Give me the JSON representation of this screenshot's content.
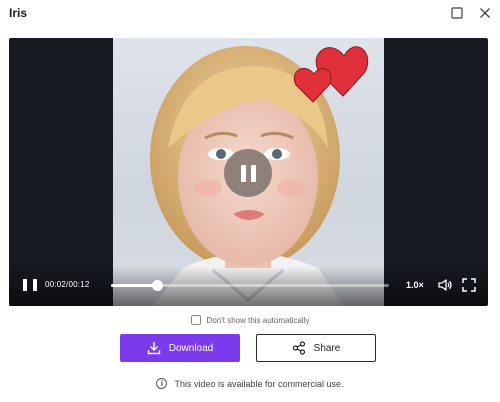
{
  "window": {
    "title": "Iris"
  },
  "player": {
    "current_time": "00:02",
    "duration": "00:12",
    "time_separator": "/",
    "progress_fraction": 0.167,
    "speed": "1.0×",
    "icons": [
      "pause-icon",
      "volume-icon",
      "fullscreen-icon",
      "center-pause-icon"
    ]
  },
  "options": {
    "dont_show_label": "Don't show this automatically",
    "dont_show_checked": false
  },
  "actions": {
    "download_label": "Download",
    "share_label": "Share"
  },
  "footer": {
    "info_icon_glyph": "i",
    "note": "This video is available for commercial use."
  },
  "colors": {
    "accent": "#7c3aed",
    "player_bg": "#161a20",
    "heart": "#e0303a"
  }
}
